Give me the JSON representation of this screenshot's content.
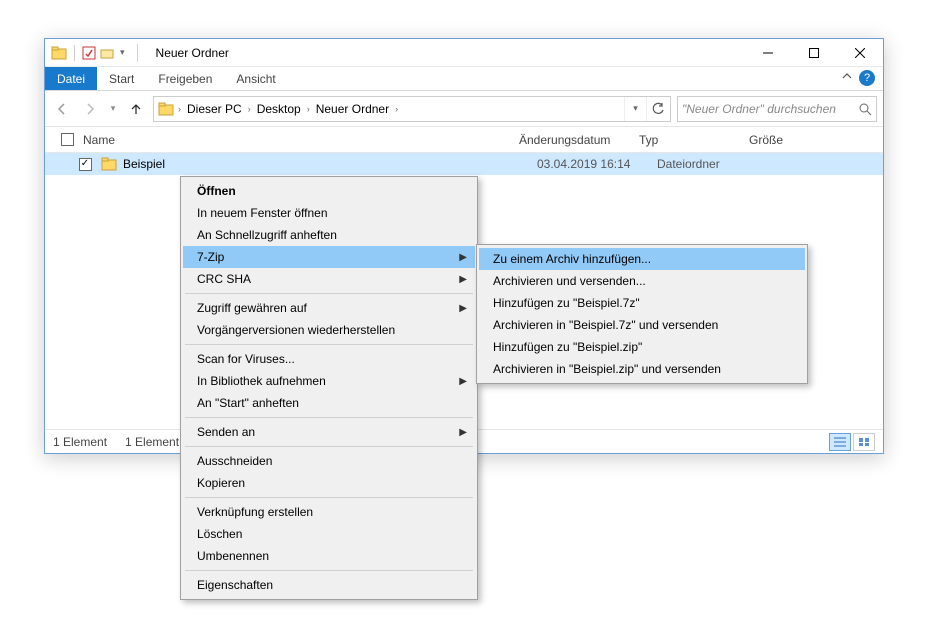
{
  "titlebar": {
    "title": "Neuer Ordner"
  },
  "ribbon": {
    "file": "Datei",
    "tabs": [
      "Start",
      "Freigeben",
      "Ansicht"
    ]
  },
  "breadcrumb": {
    "segments": [
      "Dieser PC",
      "Desktop",
      "Neuer Ordner"
    ]
  },
  "search": {
    "placeholder": "\"Neuer Ordner\" durchsuchen"
  },
  "columns": {
    "name": "Name",
    "date": "Änderungsdatum",
    "type": "Typ",
    "size": "Größe"
  },
  "row": {
    "name": "Beispiel",
    "date": "03.04.2019 16:14",
    "type": "Dateiordner",
    "size": ""
  },
  "status": {
    "count": "1 Element",
    "selected": "1 Element ausgewählt"
  },
  "context_main": {
    "open": "Öffnen",
    "new_window": "In neuem Fenster öffnen",
    "pin_quick": "An Schnellzugriff anheften",
    "seven_zip": "7-Zip",
    "crc_sha": "CRC SHA",
    "grant_access": "Zugriff gewähren auf",
    "prev_versions": "Vorgängerversionen wiederherstellen",
    "scan": "Scan for Viruses...",
    "library": "In Bibliothek aufnehmen",
    "pin_start": "An \"Start\" anheften",
    "send_to": "Senden an",
    "cut": "Ausschneiden",
    "copy": "Kopieren",
    "shortcut": "Verknüpfung erstellen",
    "delete": "Löschen",
    "rename": "Umbenennen",
    "properties": "Eigenschaften"
  },
  "context_sub": {
    "add_archive": "Zu einem Archiv hinzufügen...",
    "archive_send": "Archivieren und versenden...",
    "add_7z": "Hinzufügen zu \"Beispiel.7z\"",
    "archive_7z_send": "Archivieren in \"Beispiel.7z\" und versenden",
    "add_zip": "Hinzufügen zu \"Beispiel.zip\"",
    "archive_zip_send": "Archivieren in \"Beispiel.zip\" und versenden"
  }
}
